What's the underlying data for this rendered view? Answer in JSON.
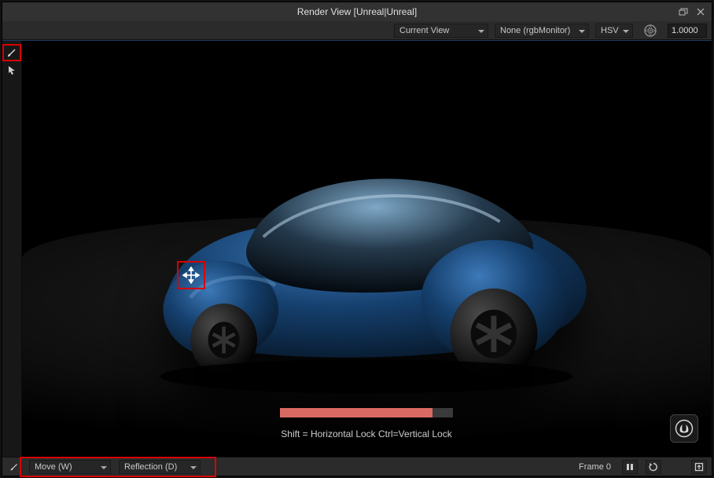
{
  "window": {
    "title": "Render View [Unreal|Unreal]"
  },
  "topbar": {
    "camera_label": "Current View",
    "monitor_label": "None (rgbMonitor)",
    "colorspace_label": "HSV",
    "exposure_value": "1.0000"
  },
  "viewport": {
    "progress_pct": 88,
    "hint_text": "Shift = Horizontal Lock   Ctrl=Vertical Lock"
  },
  "statusbar": {
    "transform_mode_label": "Move (W)",
    "reflect_label": "Reflection (D)",
    "frame_label": "Frame 0"
  },
  "icons": {
    "brush": "brush-icon",
    "arrow": "arrow-icon",
    "restore": "restore-icon",
    "close": "close-icon",
    "aperture": "aperture-icon",
    "move_cursor": "move-cursor-icon",
    "pause": "pause-icon",
    "refresh": "refresh-icon",
    "export": "export-icon",
    "ue": "unreal-logo-icon"
  }
}
